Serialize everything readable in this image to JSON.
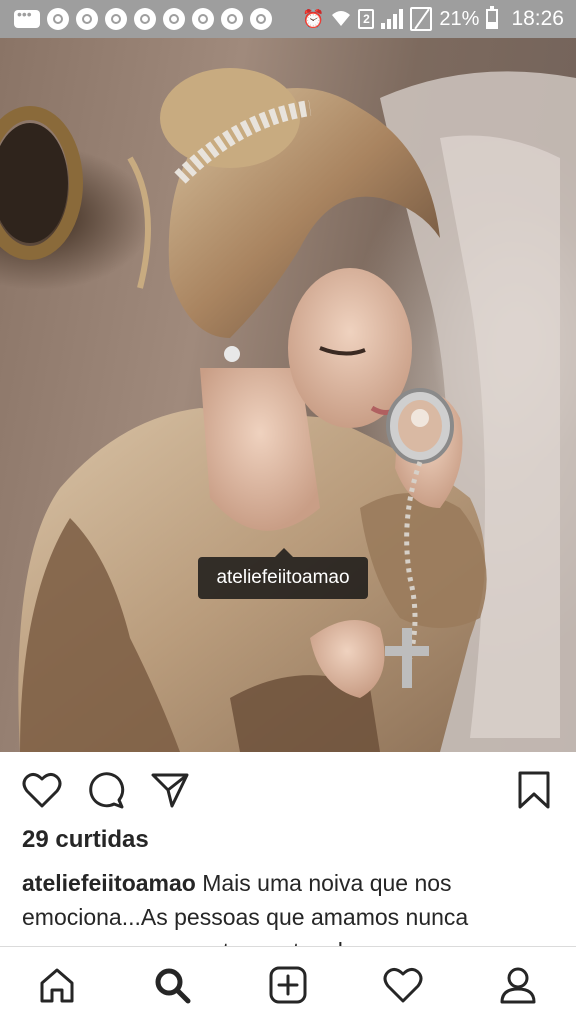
{
  "status_bar": {
    "battery": "21%",
    "time": "18:26",
    "sim_slot": "2"
  },
  "post": {
    "image_tag": "ateliefeiitoamao",
    "likes": "29 curtidas",
    "caption_user": "ateliefeiitoamao",
    "caption_text": "Mais uma noiva que nos emociona...As pessoas que amamos nunca morrem apenas partem antes de..."
  },
  "icons": {
    "like": "heart-outline-icon",
    "comment": "comment-bubble-icon",
    "share": "paper-plane-icon",
    "save": "bookmark-icon",
    "home": "home-icon",
    "search": "search-icon",
    "add": "add-post-icon",
    "activity": "heart-icon",
    "profile": "profile-icon"
  },
  "colors": {
    "status_bar": "#9e9e9e",
    "text": "#262626",
    "tag_bg": "#141414"
  }
}
